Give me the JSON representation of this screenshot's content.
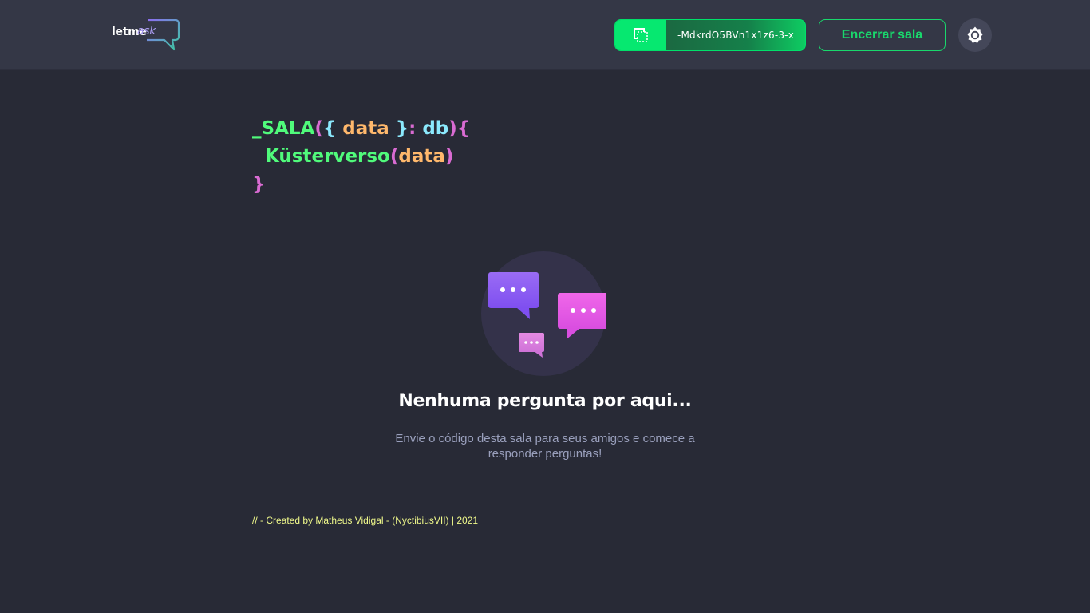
{
  "header": {
    "logo": {
      "word1": "letme",
      "word2": "ask"
    },
    "room_code": "-MdkrdO5BVn1x1z6-3-x",
    "close_room_label": "Encerrar sala",
    "theme_toggle_icon": "sun-icon"
  },
  "title": {
    "line1": {
      "prefix": "_SALA",
      "open_paren": "(",
      "open_brace": "{",
      "param": " data ",
      "close_brace": "}",
      "colon": ":",
      "type": " db",
      "close_paren": ")",
      "block_open": "{"
    },
    "line2": {
      "indent": "  ",
      "name": "Küsterverso",
      "open_paren": "(",
      "arg": "data",
      "close_paren": ")"
    },
    "line3": {
      "block_close": "}"
    }
  },
  "empty_state": {
    "illustration_icon": "chat-bubbles-icon",
    "title": "Nenhuma pergunta por aqui...",
    "subtitle": "Envie o código desta sala para seus amigos e comece a responder perguntas!"
  },
  "footer": {
    "credit": "// - Created by Matheus Vidigal - (NyctibiusVII) | 2021"
  },
  "colors": {
    "background": "#282a36",
    "header_bg": "#343746",
    "accent_green": "#50fa7b",
    "button_green": "#19d86c",
    "pink": "#d96bd2",
    "cyan": "#8be9fd",
    "orange": "#ffb86c",
    "yellow": "#f1fa8c"
  }
}
